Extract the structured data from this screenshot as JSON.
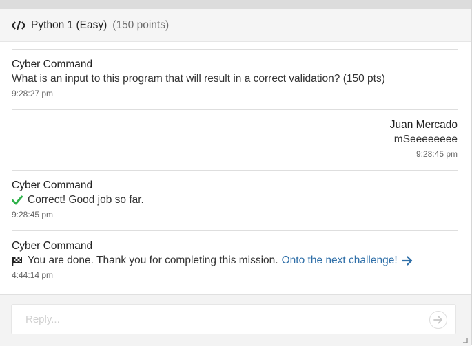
{
  "header": {
    "title": "Python 1 (Easy)",
    "points": "(150 points)",
    "icon": "code-icon"
  },
  "messages": [
    {
      "sender": "Cyber Command",
      "text": "What is an input to this program that will result in a correct validation? (150 pts)",
      "time": "9:28:27 pm"
    },
    {
      "sender": "Juan Mercado",
      "text": "mSeeeeeeee",
      "time": "9:28:45 pm"
    },
    {
      "sender": "Cyber Command",
      "icon": "check-icon",
      "text": "Correct! Good job so far.",
      "time": "9:28:45 pm"
    },
    {
      "sender": "Cyber Command",
      "icon": "checkered-flag-icon",
      "text": "You are done. Thank you for completing this mission.",
      "link_text": "Onto the next challenge!",
      "time": "4:44:14 pm"
    }
  ],
  "reply": {
    "placeholder": "Reply..."
  },
  "colors": {
    "link": "#2f6fa8",
    "check": "#2fb24a"
  }
}
